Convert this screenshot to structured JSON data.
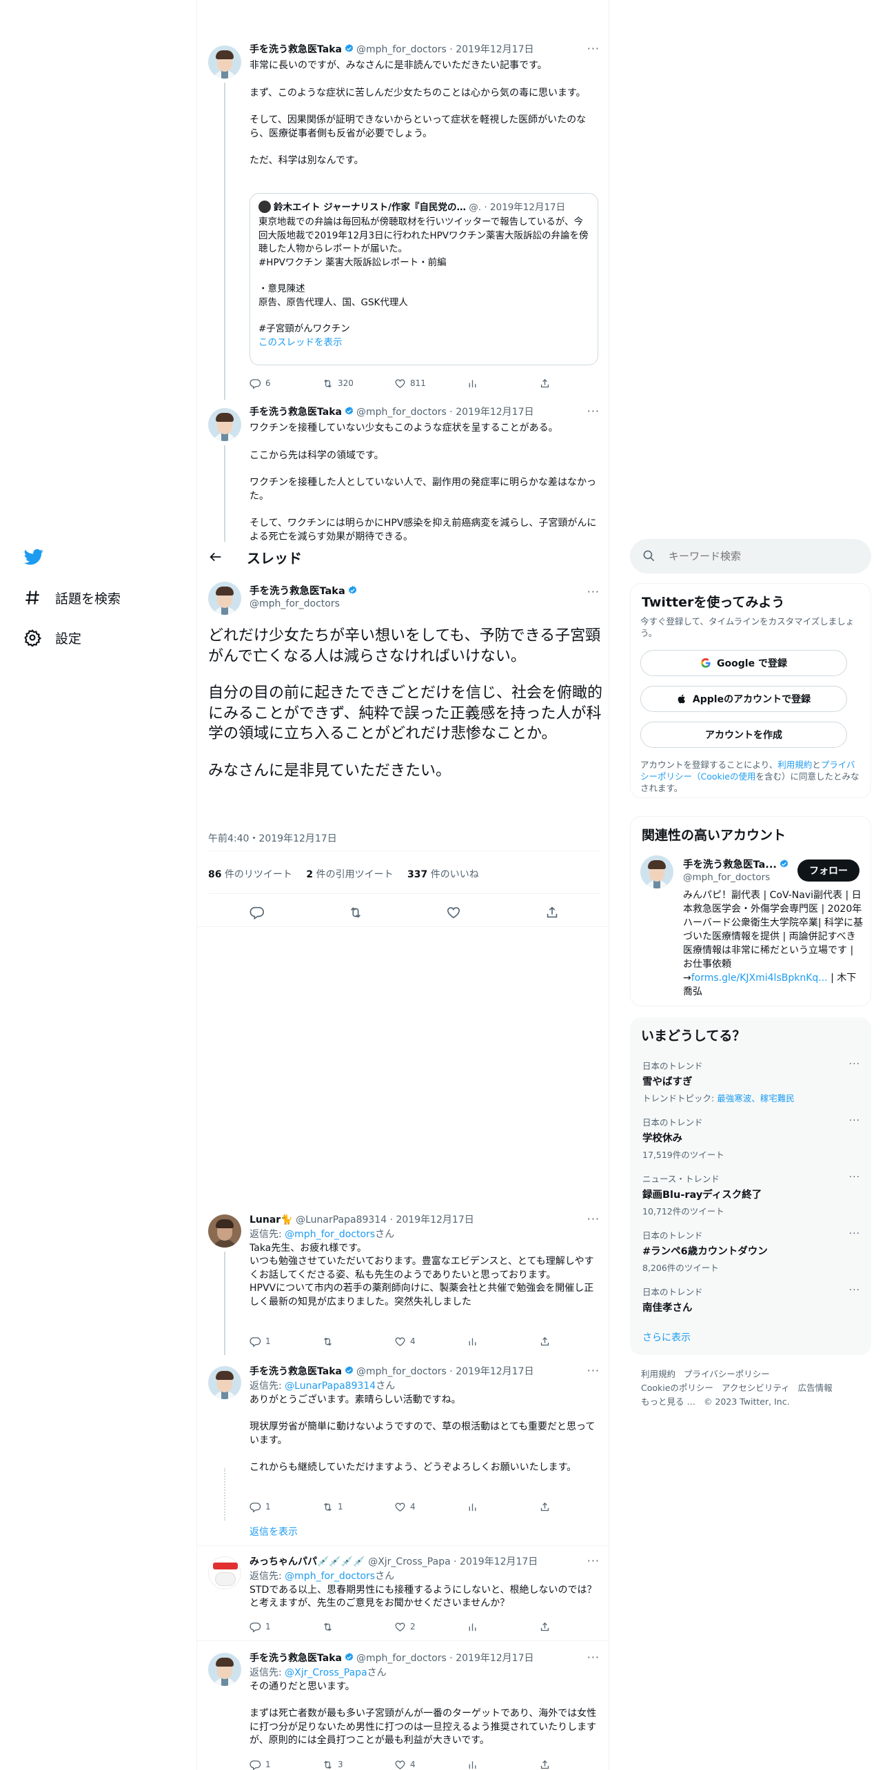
{
  "nav": {
    "explore": "話題を検索",
    "settings": "設定"
  },
  "header": {
    "title": "スレッド"
  },
  "search": {
    "placeholder": "キーワード検索"
  },
  "author": {
    "name": "手を洗う救急医Taka",
    "handle": "@mph_for_doctors"
  },
  "tweet1": {
    "date": "2019年12月17日",
    "paragraphs": [
      "非常に長いのですが、みなさんに是非読んでいただきたい記事です。",
      "まず、このような症状に苦しんだ少女たちのことは心から気の毒に思います。",
      "そして、因果関係が証明できないからといって症状を軽視した医師がいたのなら、医療従事者側も反省が必要でしょう。",
      "ただ、科学は別なんです。"
    ],
    "quote": {
      "name": "鈴木エイト ジャーナリスト/作家『自民党の…",
      "handle": "@.",
      "date": "2019年12月17日",
      "text1": "東京地裁での弁論は毎回私が傍聴取材を行いツイッターで報告しているが、今回大阪地裁で2019年12月3日に行われたHPVワクチン薬害大阪訴訟の弁論を傍聴した人物からレポートが届いた。",
      "text2": "#HPVワクチン 薬害大阪訴訟レポート・前編",
      "text3": "・意見陳述",
      "text4": "原告、原告代理人、国、GSK代理人",
      "text5": "#子宮頸がんワクチン",
      "show_thread": "このスレッドを表示"
    },
    "replies": "6",
    "retweets": "320",
    "likes": "811"
  },
  "tweet2": {
    "date": "2019年12月17日",
    "paragraphs": [
      "ワクチンを接種していない少女もこのような症状を呈することがある。",
      "ここから先は科学の領域です。",
      "ワクチンを接種した人としていない人で、副作用の発症率に明らかな差はなかった。",
      "そして、ワクチンには明らかにHPV感染を抑え前癌病変を減らし、子宮頸がんによる死亡を減らす効果が期待できる。"
    ]
  },
  "main_tweet": {
    "p1": "どれだけ少女たちが辛い想いをしても、予防できる子宮頸がんで亡くなる人は減らさなければいけない。",
    "p2": "自分の目の前に起きたできごとだけを信じ、社会を俯瞰的にみることができず、純粋で誤った正義感を持った人が科学の領域に立ち入ることがどれだけ悲惨なことか。",
    "p3": "みなさんに是非見ていただきたい。",
    "timestamp": "午前4:40・2019年12月17日",
    "retweets_num": "86",
    "retweets_label": "件のリツイート",
    "quotes_num": "2",
    "quotes_label": "件の引用ツイート",
    "likes_num": "337",
    "likes_label": "件のいいね"
  },
  "reply1": {
    "name": "Lunar🐈",
    "handle": "@LunarPapa89314",
    "date": "2019年12月17日",
    "reply_prefix": "返信先: ",
    "reply_to": "@mph_for_doctors",
    "reply_suffix": "さん",
    "lines": [
      "Taka先生、お疲れ様です。",
      "いつも勉強させていただいております。豊富なエビデンスと、とても理解しやすくお話してくださる姿、私も先生のようでありたいと思っております。",
      "HPVVについて市内の若手の薬剤師向けに、製薬会社と共催で勉強会を開催し正しく最新の知見が広まりました。突然失礼しました"
    ],
    "replies": "1",
    "retweets": "",
    "likes": "4"
  },
  "reply2": {
    "date": "2019年12月17日",
    "reply_prefix": "返信先: ",
    "reply_to": "@LunarPapa89314",
    "reply_suffix": "さん",
    "paragraphs": [
      "ありがとうございます。素晴らしい活動ですね。",
      "現状厚労省が簡単に動けないようですので、草の根活動はとても重要だと思っています。",
      "これからも継続していただけますよう、どうぞよろしくお願いいたします。"
    ],
    "replies": "1",
    "retweets": "1",
    "likes": "4",
    "show_replies": "返信を表示"
  },
  "reply3": {
    "name": "みっちゃんパパ💉💉💉💉",
    "handle": "@Xjr_Cross_Papa",
    "date": "2019年12月17日",
    "reply_prefix": "返信先: ",
    "reply_to": "@mph_for_doctors",
    "reply_suffix": "さん",
    "text": "STDである以上、思春期男性にも接種するようにしないと、根絶しないのでは？と考えますが、先生のご意見をお聞かせくださいませんか？",
    "replies": "1",
    "retweets": "",
    "likes": "2"
  },
  "reply4": {
    "date": "2019年12月17日",
    "reply_prefix": "返信先: ",
    "reply_to": "@Xjr_Cross_Papa",
    "reply_suffix": "さん",
    "paragraphs": [
      "その通りだと思います。",
      "まずは死亡者数が最も多い子宮頸がんが一番のターゲットであり、海外では女性に打つ分が足りないため男性に打つのは一旦控えるよう推奨されていたりしますが、原則的には全員打つことが最も利益が大きいです。"
    ],
    "replies": "1",
    "retweets": "3",
    "likes": "4"
  },
  "signup": {
    "title": "Twitterを使ってみよう",
    "sub": "今すぐ登録して、タイムラインをカスタマイズしましょう。",
    "google": "Google で登録",
    "apple": "Appleのアカウントで登録",
    "create": "アカウントを作成",
    "terms_prefix": "アカウントを登録することにより、",
    "terms_link": "利用規約",
    "terms_and": "と",
    "privacy_link": "プライバシーポリシー",
    "cookie_open": "（",
    "cookie_link": "Cookieの使用",
    "terms_suffix": "を含む）に同意したとみなされます。"
  },
  "related": {
    "title": "関連性の高いアカウント",
    "name": "手を洗う救急医Ta...",
    "handle": "@mph_for_doctors",
    "follow": "フォロー",
    "bio": "みんパピ！副代表 | CoV-Navi副代表 | 日本救急医学会・外傷学会専門医 | 2020年ハーバード公衆衛生大学院卒業| 科学に基づいた医療情報を提供 | 両論併記すべき医療情報は非常に稀だという立場です | お仕事依頼→",
    "bio_link": "forms.gle/KJXmi4lsBpknKq...",
    "bio_suffix": " | 木下喬弘"
  },
  "trends": {
    "title": "いまどうしてる？",
    "items": [
      {
        "category": "日本のトレンド",
        "name": "雪やばすぎ",
        "sub_prefix": "トレンドトピック: ",
        "sub_links": "最強寒波、稼宅難民"
      },
      {
        "category": "日本のトレンド",
        "name": "学校休み",
        "sub": "17,519件のツイート"
      },
      {
        "category": "ニュース・トレンド",
        "name": "録画Blu-rayディスク終了",
        "sub": "10,712件のツイート"
      },
      {
        "category": "日本のトレンド",
        "name": "#ランペ6歳カウントダウン",
        "sub": "8,206件のツイート"
      },
      {
        "category": "日本のトレンド",
        "name": "南佳孝さん"
      }
    ],
    "show_more": "さらに表示"
  },
  "footer": {
    "terms": "利用規約",
    "privacy": "プライバシーポリシー",
    "cookie": "Cookieのポリシー",
    "accessibility": "アクセシビリティ",
    "ads": "広告情報",
    "more": "もっと見る …",
    "copyright": "© 2023 Twitter, Inc."
  },
  "colors": {
    "accent": "#1d9bf0",
    "text": "#0f1419",
    "muted": "#536471",
    "border": "#eff3f4"
  },
  "icons": [
    "twitter-logo-icon",
    "hashtag-icon",
    "gear-icon",
    "back-arrow-icon",
    "search-icon",
    "verified-icon",
    "reply-icon",
    "retweet-icon",
    "like-icon",
    "analytics-icon",
    "share-icon",
    "google-icon",
    "apple-icon",
    "more-icon"
  ]
}
